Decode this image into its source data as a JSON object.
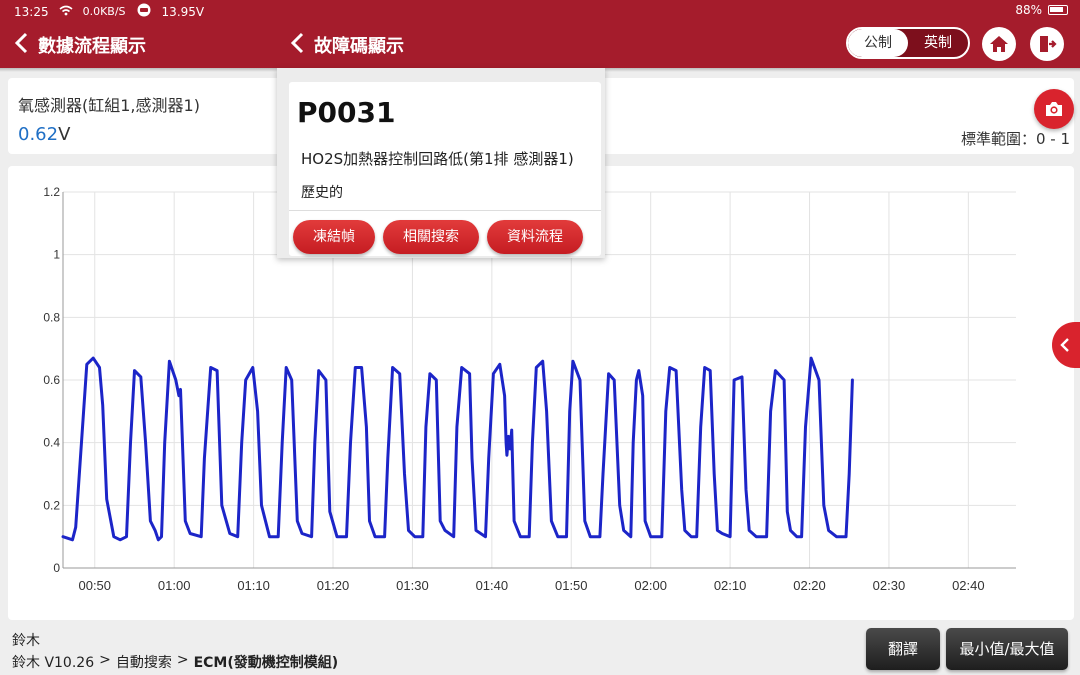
{
  "status_bar": {
    "time": "13:25",
    "net_speed": "0.0KB/S",
    "voltage": "13.95V",
    "battery": "88%"
  },
  "header": {
    "back_title": "數據流程顯示",
    "popup_back_title": "故障碼顯示",
    "unit_metric": "公制",
    "unit_imperial": "英制",
    "home_icon": "home-icon",
    "exit_icon": "exit-icon"
  },
  "sensor": {
    "name": "氧感測器(缸組1,感測器1)",
    "value": "0.62",
    "unit": "V",
    "range": "標準範圍：0 - 1"
  },
  "popup": {
    "code": "P0031",
    "description": "HO2S加熱器控制回路低(第1排 感測器1)",
    "status": "歷史的",
    "buttons": [
      "凍結幀",
      "相關搜索",
      "資料流程"
    ]
  },
  "chart_data": {
    "type": "line",
    "x": [
      "00:50",
      "01:00",
      "01:10",
      "01:20",
      "01:30",
      "01:40",
      "01:50",
      "02:00",
      "02:10",
      "02:20",
      "02:30",
      "02:40"
    ],
    "ylim": [
      0,
      1.2
    ],
    "yticks": [
      "0",
      "0.2",
      "0.4",
      "0.6",
      "0.8",
      "1",
      "1.2"
    ],
    "xlim_seconds": [
      46,
      166
    ],
    "grid": true,
    "color": "#1c25c8",
    "series": [
      {
        "points": [
          [
            46.0,
            0.1
          ],
          [
            47.2,
            0.09
          ],
          [
            47.6,
            0.13
          ],
          [
            48.6,
            0.5
          ],
          [
            49.0,
            0.65
          ],
          [
            49.8,
            0.67
          ],
          [
            50.6,
            0.64
          ],
          [
            51.0,
            0.52
          ],
          [
            51.5,
            0.22
          ],
          [
            52.4,
            0.1
          ],
          [
            53.2,
            0.09
          ],
          [
            54.0,
            0.1
          ],
          [
            54.5,
            0.4
          ],
          [
            55.0,
            0.63
          ],
          [
            55.8,
            0.61
          ],
          [
            56.4,
            0.4
          ],
          [
            57.0,
            0.15
          ],
          [
            57.6,
            0.12
          ],
          [
            58.0,
            0.09
          ],
          [
            58.4,
            0.1
          ],
          [
            58.8,
            0.4
          ],
          [
            59.4,
            0.66
          ],
          [
            60.2,
            0.6
          ],
          [
            60.6,
            0.55
          ],
          [
            60.8,
            0.57
          ],
          [
            61.4,
            0.15
          ],
          [
            62.0,
            0.11
          ],
          [
            63.4,
            0.1
          ],
          [
            63.8,
            0.35
          ],
          [
            64.6,
            0.64
          ],
          [
            65.4,
            0.63
          ],
          [
            66.0,
            0.2
          ],
          [
            67.0,
            0.11
          ],
          [
            68.0,
            0.1
          ],
          [
            68.5,
            0.4
          ],
          [
            69.0,
            0.6
          ],
          [
            69.9,
            0.64
          ],
          [
            70.5,
            0.5
          ],
          [
            71.0,
            0.2
          ],
          [
            72.0,
            0.1
          ],
          [
            73.1,
            0.1
          ],
          [
            73.6,
            0.4
          ],
          [
            74.1,
            0.64
          ],
          [
            74.8,
            0.6
          ],
          [
            75.5,
            0.15
          ],
          [
            76.1,
            0.11
          ],
          [
            77.3,
            0.1
          ],
          [
            77.7,
            0.4
          ],
          [
            78.2,
            0.63
          ],
          [
            79.1,
            0.6
          ],
          [
            79.6,
            0.18
          ],
          [
            80.5,
            0.1
          ],
          [
            81.7,
            0.1
          ],
          [
            82.2,
            0.4
          ],
          [
            82.8,
            0.64
          ],
          [
            83.6,
            0.64
          ],
          [
            84.2,
            0.45
          ],
          [
            84.6,
            0.15
          ],
          [
            85.3,
            0.1
          ],
          [
            86.5,
            0.1
          ],
          [
            86.9,
            0.35
          ],
          [
            87.5,
            0.64
          ],
          [
            88.4,
            0.62
          ],
          [
            89.0,
            0.3
          ],
          [
            89.5,
            0.12
          ],
          [
            90.3,
            0.1
          ],
          [
            91.3,
            0.1
          ],
          [
            91.7,
            0.45
          ],
          [
            92.2,
            0.62
          ],
          [
            93.0,
            0.6
          ],
          [
            93.5,
            0.15
          ],
          [
            94.1,
            0.12
          ],
          [
            95.2,
            0.1
          ],
          [
            95.6,
            0.45
          ],
          [
            96.2,
            0.64
          ],
          [
            97.2,
            0.62
          ],
          [
            97.5,
            0.35
          ],
          [
            98.0,
            0.12
          ],
          [
            99.2,
            0.1
          ],
          [
            99.6,
            0.35
          ],
          [
            100.2,
            0.62
          ],
          [
            101.0,
            0.65
          ],
          [
            101.6,
            0.55
          ],
          [
            101.8,
            0.4
          ],
          [
            101.9,
            0.36
          ],
          [
            102.1,
            0.42
          ],
          [
            102.3,
            0.38
          ],
          [
            102.5,
            0.44
          ],
          [
            102.8,
            0.15
          ],
          [
            103.6,
            0.1
          ],
          [
            104.7,
            0.1
          ],
          [
            105.1,
            0.4
          ],
          [
            105.6,
            0.64
          ],
          [
            106.4,
            0.66
          ],
          [
            106.9,
            0.5
          ],
          [
            107.5,
            0.15
          ],
          [
            108.3,
            0.1
          ],
          [
            109.4,
            0.1
          ],
          [
            109.8,
            0.5
          ],
          [
            110.2,
            0.66
          ],
          [
            111.1,
            0.6
          ],
          [
            111.7,
            0.15
          ],
          [
            112.4,
            0.1
          ],
          [
            113.6,
            0.1
          ],
          [
            114.0,
            0.3
          ],
          [
            114.7,
            0.62
          ],
          [
            115.4,
            0.6
          ],
          [
            116.1,
            0.2
          ],
          [
            116.6,
            0.12
          ],
          [
            117.5,
            0.1
          ],
          [
            117.8,
            0.4
          ],
          [
            118.2,
            0.6
          ],
          [
            118.5,
            0.63
          ],
          [
            119.0,
            0.55
          ],
          [
            119.3,
            0.15
          ],
          [
            120.0,
            0.1
          ],
          [
            121.4,
            0.1
          ],
          [
            121.9,
            0.5
          ],
          [
            122.4,
            0.64
          ],
          [
            123.2,
            0.63
          ],
          [
            123.9,
            0.25
          ],
          [
            124.3,
            0.12
          ],
          [
            125.1,
            0.1
          ],
          [
            125.8,
            0.1
          ],
          [
            126.3,
            0.45
          ],
          [
            126.8,
            0.64
          ],
          [
            127.5,
            0.63
          ],
          [
            128.0,
            0.3
          ],
          [
            128.4,
            0.12
          ],
          [
            129.0,
            0.11
          ],
          [
            130.0,
            0.1
          ],
          [
            130.5,
            0.6
          ],
          [
            131.5,
            0.61
          ],
          [
            132.0,
            0.25
          ],
          [
            132.4,
            0.12
          ],
          [
            133.3,
            0.1
          ],
          [
            134.6,
            0.1
          ],
          [
            135.1,
            0.5
          ],
          [
            135.7,
            0.63
          ],
          [
            136.8,
            0.6
          ],
          [
            137.2,
            0.18
          ],
          [
            137.6,
            0.12
          ],
          [
            138.4,
            0.1
          ],
          [
            139.0,
            0.1
          ],
          [
            139.5,
            0.45
          ],
          [
            140.2,
            0.67
          ],
          [
            141.2,
            0.6
          ],
          [
            141.8,
            0.2
          ],
          [
            142.4,
            0.12
          ],
          [
            143.4,
            0.1
          ],
          [
            144.6,
            0.1
          ],
          [
            145.0,
            0.3
          ],
          [
            145.4,
            0.6
          ]
        ]
      }
    ]
  },
  "footer": {
    "brand": "鈴木",
    "path_version": "鈴木 V10.26",
    "path_sep": ">",
    "path_step": "自動搜索",
    "path_module": "ECM(發動機控制模組)",
    "btn_translate": "翻譯",
    "btn_minmax": "最小值/最大值"
  }
}
